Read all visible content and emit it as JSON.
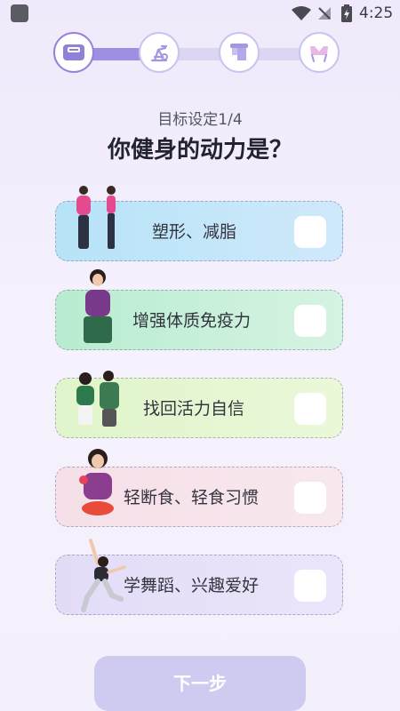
{
  "status_bar": {
    "time": "4:25"
  },
  "stepper": {
    "steps": [
      {
        "icon": "scale-icon",
        "state": "active"
      },
      {
        "icon": "exercise-bike-icon",
        "state": "pending"
      },
      {
        "icon": "towel-icon",
        "state": "pending"
      },
      {
        "icon": "sports-bra-icon",
        "state": "pending"
      }
    ],
    "progress": 0.33
  },
  "header": {
    "subtitle": "目标设定1/4",
    "title": "你健身的动力是？"
  },
  "options": [
    {
      "label": "塑形、减脂",
      "checked": false
    },
    {
      "label": "增强体质免疫力",
      "checked": false
    },
    {
      "label": "找回活力自信",
      "checked": false
    },
    {
      "label": "轻断食、轻食习惯",
      "checked": false
    },
    {
      "label": "学舞蹈、兴趣爱好",
      "checked": false
    }
  ],
  "footer": {
    "next_label": "下一步"
  },
  "colors": {
    "accent": "#9e8fe0",
    "button_disabled": "#cfcbf0",
    "option1_bg": "#b7e3f7",
    "option2_bg": "#b8ecd1",
    "option3_bg": "#e0f5cb",
    "option4_bg": "#f6dfe8",
    "option5_bg": "#e3dcf7"
  }
}
